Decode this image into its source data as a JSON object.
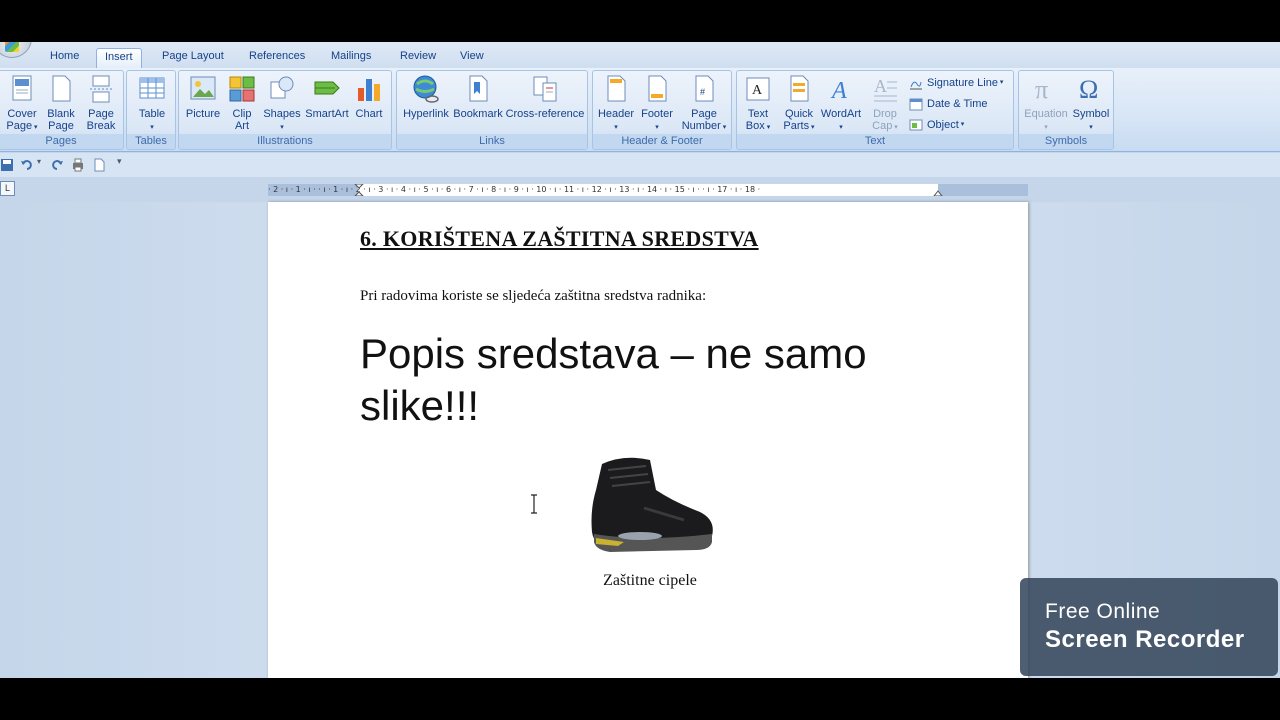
{
  "tabs": [
    {
      "label": "Home"
    },
    {
      "label": "Insert"
    },
    {
      "label": "Page Layout"
    },
    {
      "label": "References"
    },
    {
      "label": "Mailings"
    },
    {
      "label": "Review"
    },
    {
      "label": "View"
    }
  ],
  "ribbon": {
    "pages": {
      "label": "Pages",
      "cover_page": "Cover Page",
      "cover_page_line1": "Cover",
      "cover_page_line2": "Page",
      "blank_page_line1": "Blank",
      "blank_page_line2": "Page",
      "page_break_line1": "Page",
      "page_break_line2": "Break"
    },
    "tables": {
      "label": "Tables",
      "table": "Table"
    },
    "illustrations": {
      "label": "Illustrations",
      "picture": "Picture",
      "clip_art_line1": "Clip",
      "clip_art_line2": "Art",
      "shapes": "Shapes",
      "smartart": "SmartArt",
      "chart": "Chart"
    },
    "links": {
      "label": "Links",
      "hyperlink": "Hyperlink",
      "bookmark": "Bookmark",
      "cross_reference": "Cross-reference"
    },
    "header_footer": {
      "label": "Header & Footer",
      "header": "Header",
      "footer": "Footer",
      "page_number_line1": "Page",
      "page_number_line2": "Number"
    },
    "text": {
      "label": "Text",
      "text_box_line1": "Text",
      "text_box_line2": "Box",
      "quick_parts_line1": "Quick",
      "quick_parts_line2": "Parts",
      "wordart": "WordArt",
      "drop_cap_line1": "Drop",
      "drop_cap_line2": "Cap",
      "signature_line": "Signature Line",
      "date_time": "Date & Time",
      "object": "Object"
    },
    "symbols": {
      "label": "Symbols",
      "equation": "Equation",
      "symbol": "Symbol"
    }
  },
  "ruler": {
    "numbers": "· 2 · ı · 1 · ı ·  · ı · 1 · ı · 2 · ı · 3 · ı · 4 · ı · 5 · ı · 6 · ı · 7 · ı · 8 · ı · 9 · ı · 10 · ı · 11 · ı · 12 · ı · 13 · ı · 14 · ı · 15 · ı ·  · ı · 17 · ı · 18 ·"
  },
  "tab_selector": "L",
  "document": {
    "heading": "6. KORIŠTENA ZAŠTITNA SREDSTVA",
    "paragraph": "Pri radovima koriste se sljedeća zaštitna sredstva radnika:",
    "big_text": "Popis sredstava – ne samo slike!!!",
    "caption": "Zaštitne cipele"
  },
  "watermark": {
    "line1": "Free Online",
    "line2": "Screen Recorder"
  }
}
